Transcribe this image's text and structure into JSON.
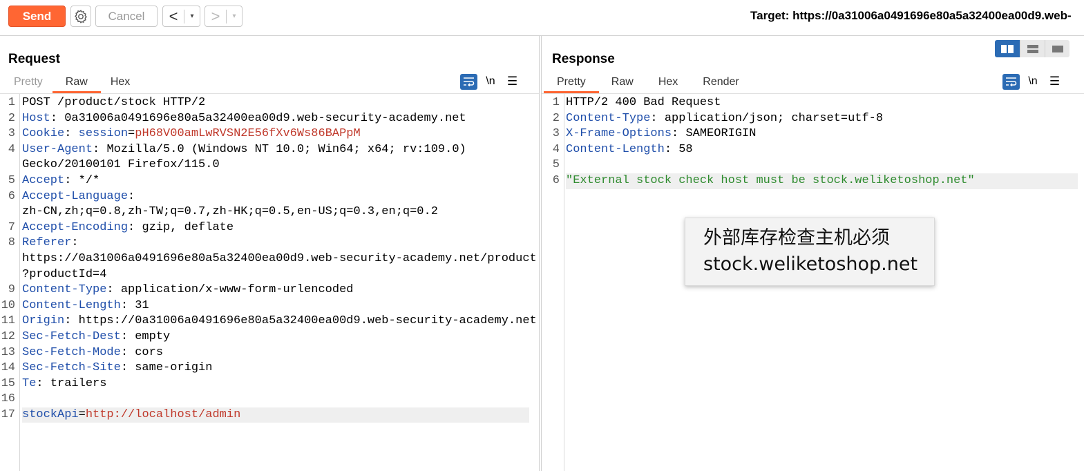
{
  "toolbar": {
    "send_label": "Send",
    "cancel_label": "Cancel",
    "back_arrow": "<",
    "forward_arrow": ">",
    "dropdown_glyph": "▾",
    "target_text": "Target: https://0a31006a0491696e80a5a32400ea00d9.web-"
  },
  "colors": {
    "accent": "#ff6633",
    "header_name": "#1f4eaa",
    "value_red": "#c0392b",
    "string_green": "#2e8b2e",
    "tool_blue": "#2b6bb4"
  },
  "request": {
    "title": "Request",
    "tabs": [
      {
        "label": "Pretty"
      },
      {
        "label": "Raw"
      },
      {
        "label": "Hex"
      }
    ],
    "active_tab": "Raw",
    "newline_label": "\\n",
    "menu_glyph": "☰",
    "lines": [
      {
        "n": "1",
        "text": "POST /product/stock HTTP/2"
      },
      {
        "n": "2",
        "name": "Host",
        "sep": ": ",
        "value": "0a31006a0491696e80a5a32400ea00d9.web-security-academy.net"
      },
      {
        "n": "3",
        "name": "Cookie",
        "sep": ": ",
        "key": "session",
        "eq": "=",
        "session": "pH68V00amLwRVSN2E56fXv6Ws86BAPpM"
      },
      {
        "n": "4",
        "name": "User-Agent",
        "sep": ": ",
        "value": "Mozilla/5.0 (Windows NT 10.0; Win64; x64; rv:109.0)"
      },
      {
        "n": "",
        "text": "Gecko/20100101 Firefox/115.0"
      },
      {
        "n": "5",
        "name": "Accept",
        "sep": ": ",
        "value": "*/*"
      },
      {
        "n": "6",
        "name": "Accept-Language",
        "sep": ":",
        "value": ""
      },
      {
        "n": "",
        "text": "zh-CN,zh;q=0.8,zh-TW;q=0.7,zh-HK;q=0.5,en-US;q=0.3,en;q=0.2"
      },
      {
        "n": "7",
        "name": "Accept-Encoding",
        "sep": ": ",
        "value": "gzip, deflate"
      },
      {
        "n": "8",
        "name": "Referer",
        "sep": ":",
        "value": ""
      },
      {
        "n": "",
        "text": "https://0a31006a0491696e80a5a32400ea00d9.web-security-academy.net/product"
      },
      {
        "n": "",
        "text": "?productId=4"
      },
      {
        "n": "9",
        "name": "Content-Type",
        "sep": ": ",
        "value": "application/x-www-form-urlencoded"
      },
      {
        "n": "10",
        "name": "Content-Length",
        "sep": ": ",
        "value": "31"
      },
      {
        "n": "11",
        "name": "Origin",
        "sep": ": ",
        "value": "https://0a31006a0491696e80a5a32400ea00d9.web-security-academy.net"
      },
      {
        "n": "12",
        "name": "Sec-Fetch-Dest",
        "sep": ": ",
        "value": "empty"
      },
      {
        "n": "13",
        "name": "Sec-Fetch-Mode",
        "sep": ": ",
        "value": "cors"
      },
      {
        "n": "14",
        "name": "Sec-Fetch-Site",
        "sep": ": ",
        "value": "same-origin"
      },
      {
        "n": "15",
        "name": "Te",
        "sep": ": ",
        "value": "trailers"
      },
      {
        "n": "16",
        "text": ""
      },
      {
        "n": "17",
        "param": "stockApi",
        "eq": "=",
        "pvalue": "http://localhost/admin",
        "highlight": true
      }
    ]
  },
  "response": {
    "title": "Response",
    "tabs": [
      {
        "label": "Pretty"
      },
      {
        "label": "Raw"
      },
      {
        "label": "Hex"
      },
      {
        "label": "Render"
      }
    ],
    "active_tab": "Pretty",
    "newline_label": "\\n",
    "menu_glyph": "☰",
    "lines": [
      {
        "n": "1",
        "text": "HTTP/2 400 Bad Request"
      },
      {
        "n": "2",
        "name": "Content-Type",
        "sep": ": ",
        "value": "application/json; charset=utf-8"
      },
      {
        "n": "3",
        "name": "X-Frame-Options",
        "sep": ": ",
        "value": "SAMEORIGIN"
      },
      {
        "n": "4",
        "name": "Content-Length",
        "sep": ": ",
        "value": "58"
      },
      {
        "n": "5",
        "text": ""
      },
      {
        "n": "6",
        "string": "\"External stock check host must be stock.weliketoshop.net\"",
        "highlight": true
      }
    ]
  },
  "note": {
    "line1": "外部库存检查主机必须",
    "line2": "stock.weliketoshop.net"
  }
}
